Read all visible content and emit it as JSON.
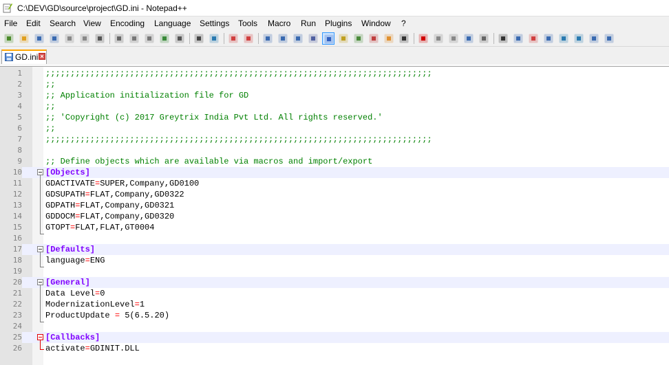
{
  "window": {
    "title": "C:\\DEV\\GD\\source\\project\\GD.ini - Notepad++"
  },
  "menu": [
    "File",
    "Edit",
    "Search",
    "View",
    "Encoding",
    "Language",
    "Settings",
    "Tools",
    "Macro",
    "Run",
    "Plugins",
    "Window",
    "?"
  ],
  "toolbar": {
    "buttons": [
      "new-file",
      "open-file",
      "save",
      "save-all",
      "close",
      "close-all",
      "print",
      "cut",
      "copy",
      "paste",
      "undo",
      "redo",
      "find",
      "replace",
      "zoom-in",
      "zoom-out",
      "sync-vertical",
      "sync-horizontal",
      "word-wrap",
      "show-all-characters",
      "indent-guide",
      "user-defined-language",
      "document-map",
      "function-list",
      "folder-as-workspace",
      "monitoring",
      "record-macro",
      "stop-recording",
      "playback-macro",
      "run-macro-multiple",
      "save-macro",
      "insert-row",
      "document-list",
      "compare",
      "fold-all",
      "move-up",
      "move-down",
      "clear",
      "panel"
    ],
    "active": "indent-guide"
  },
  "tabs": [
    {
      "label": "GD.ini"
    }
  ],
  "editor": {
    "lines": [
      {
        "n": "1",
        "parts": [
          {
            "t": ";;;;;;;;;;;;;;;;;;;;;;;;;;;;;;;;;;;;;;;;;;;;;;;;;;;;;;;;;;;;;;;;;;;;;;;;;;;;;;",
            "c": "c-comment"
          }
        ]
      },
      {
        "n": "2",
        "parts": [
          {
            "t": ";;",
            "c": "c-comment"
          }
        ]
      },
      {
        "n": "3",
        "parts": [
          {
            "t": ";; Application initialization file for GD",
            "c": "c-comment"
          }
        ]
      },
      {
        "n": "4",
        "parts": [
          {
            "t": ";;",
            "c": "c-comment"
          }
        ]
      },
      {
        "n": "5",
        "parts": [
          {
            "t": ";; 'Copyright (c) 2017 Greytrix India Pvt Ltd. All rights reserved.'",
            "c": "c-comment"
          }
        ]
      },
      {
        "n": "6",
        "parts": [
          {
            "t": ";;",
            "c": "c-comment"
          }
        ]
      },
      {
        "n": "7",
        "parts": [
          {
            "t": ";;;;;;;;;;;;;;;;;;;;;;;;;;;;;;;;;;;;;;;;;;;;;;;;;;;;;;;;;;;;;;;;;;;;;;;;;;;;;;",
            "c": "c-comment"
          }
        ]
      },
      {
        "n": "8",
        "parts": []
      },
      {
        "n": "9",
        "parts": [
          {
            "t": ";; Define objects which are available via macros and import/export",
            "c": "c-comment"
          }
        ]
      },
      {
        "n": "10",
        "band": true,
        "parts": [
          {
            "t": "[Objects]",
            "c": "c-section"
          }
        ]
      },
      {
        "n": "11",
        "parts": [
          {
            "t": "GDACTIVATE"
          },
          {
            "t": "=",
            "c": "c-eq"
          },
          {
            "t": "SUPER,Company,GD0100"
          }
        ]
      },
      {
        "n": "12",
        "parts": [
          {
            "t": "GDSUPATH"
          },
          {
            "t": "=",
            "c": "c-eq"
          },
          {
            "t": "FLAT,Company,GD0322"
          }
        ]
      },
      {
        "n": "13",
        "parts": [
          {
            "t": "GDPATH"
          },
          {
            "t": "=",
            "c": "c-eq"
          },
          {
            "t": "FLAT,Company,GD0321"
          }
        ]
      },
      {
        "n": "14",
        "parts": [
          {
            "t": "GDDOCM"
          },
          {
            "t": "=",
            "c": "c-eq"
          },
          {
            "t": "FLAT,Company,GD0320"
          }
        ]
      },
      {
        "n": "15",
        "parts": [
          {
            "t": "GTOPT"
          },
          {
            "t": "=",
            "c": "c-eq"
          },
          {
            "t": "FLAT,FLAT,GT0004"
          }
        ]
      },
      {
        "n": "16",
        "parts": []
      },
      {
        "n": "17",
        "band": true,
        "parts": [
          {
            "t": "[Defaults]",
            "c": "c-section"
          }
        ]
      },
      {
        "n": "18",
        "parts": [
          {
            "t": "language"
          },
          {
            "t": "=",
            "c": "c-eq"
          },
          {
            "t": "ENG"
          }
        ]
      },
      {
        "n": "19",
        "parts": []
      },
      {
        "n": "20",
        "band": true,
        "parts": [
          {
            "t": "[General]",
            "c": "c-section"
          }
        ]
      },
      {
        "n": "21",
        "parts": [
          {
            "t": "Data Level"
          },
          {
            "t": "=",
            "c": "c-eq"
          },
          {
            "t": "0"
          }
        ]
      },
      {
        "n": "22",
        "parts": [
          {
            "t": "ModernizationLevel"
          },
          {
            "t": "=",
            "c": "c-eq"
          },
          {
            "t": "1"
          }
        ]
      },
      {
        "n": "23",
        "parts": [
          {
            "t": "ProductUpdate "
          },
          {
            "t": "=",
            "c": "c-eq"
          },
          {
            "t": " 5(6.5.20)"
          }
        ]
      },
      {
        "n": "24",
        "parts": []
      },
      {
        "n": "25",
        "band": true,
        "parts": [
          {
            "t": "[Callbacks]",
            "c": "c-section"
          }
        ]
      },
      {
        "n": "26",
        "parts": [
          {
            "t": "activate"
          },
          {
            "t": "=",
            "c": "c-eq"
          },
          {
            "t": "GDINIT.DLL"
          }
        ]
      }
    ]
  }
}
